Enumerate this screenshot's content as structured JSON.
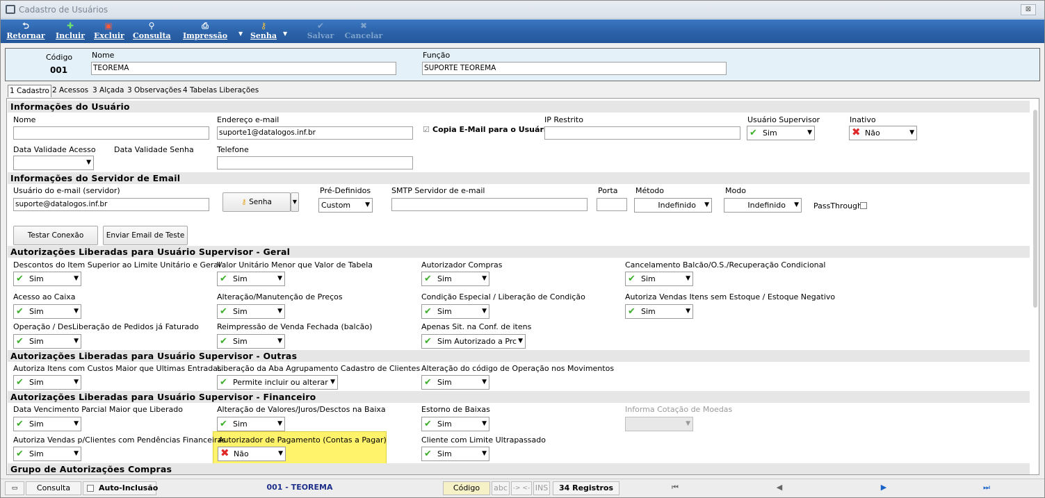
{
  "window": {
    "title": "Cadastro de Usuários",
    "close_label": "⊠"
  },
  "toolbar": {
    "retornar": "Retornar",
    "incluir": "Incluir",
    "excluir": "Excluir",
    "consulta": "Consulta",
    "impressao": "Impressão",
    "senha": "Senha",
    "salvar": "Salvar",
    "cancelar": "Cancelar"
  },
  "header": {
    "codigo_label": "Código",
    "codigo_value": "001",
    "nome_label": "Nome",
    "nome_value": "TEOREMA",
    "funcao_label": "Função",
    "funcao_value": "SUPORTE TEOREMA"
  },
  "tabs": [
    "1 Cadastro",
    "2 Acessos",
    "3 Alçada",
    "3 Observações",
    "4 Tabelas Liberações"
  ],
  "usuario": {
    "section": "Informações do Usuário",
    "nome_label": "Nome",
    "nome_value": "",
    "email_label": "Endereço e-mail",
    "email_value": "suporte1@datalogos.inf.br",
    "copia_label": "Copia E-Mail para o Usuário",
    "ip_label": "IP Restrito",
    "ip_value": "",
    "supervisor_label": "Usuário Supervisor",
    "supervisor_value": "Sim",
    "inativo_label": "Inativo",
    "inativo_value": "Não",
    "validade_acesso_label": "Data Validade Acesso",
    "validade_senha_label": "Data Validade Senha",
    "telefone_label": "Telefone",
    "telefone_value": ""
  },
  "servidor": {
    "section": "Informações do Servidor de Email",
    "usuario_label": "Usuário do e-mail (servidor)",
    "usuario_value": "suporte@datalogos.inf.br",
    "senha_button": "Senha",
    "predef_label": "Pré-Definidos",
    "predef_value": "Custom",
    "smtp_label": "SMTP Servidor de e-mail",
    "smtp_value": "",
    "porta_label": "Porta",
    "porta_value": "",
    "metodo_label": "Método",
    "metodo_value": "Indefinido",
    "modo_label": "Modo",
    "modo_value": "Indefinido",
    "passthrough_label": "PassThrough",
    "testar_button": "Testar Conexão",
    "enviar_button": "Enviar Email de Teste"
  },
  "geral": {
    "section": "Autorizações Liberadas para Usuário Supervisor - Geral",
    "items": [
      {
        "label": "Descontos do Item Superior ao Limite Unitário e Geral",
        "value": "Sim"
      },
      {
        "label": "Valor Unitário Menor que Valor de Tabela",
        "value": "Sim"
      },
      {
        "label": "Autorizador Compras",
        "value": "Sim"
      },
      {
        "label": "Cancelamento Balcão/O.S./Recuperação Condicional",
        "value": "Sim"
      },
      {
        "label": "Acesso ao Caixa",
        "value": "Sim"
      },
      {
        "label": "Alteração/Manutenção de Preços",
        "value": "Sim"
      },
      {
        "label": "Condição Especial / Liberação de Condição",
        "value": "Sim"
      },
      {
        "label": "Autoriza Vendas Itens sem Estoque / Estoque Negativo",
        "value": "Sim"
      },
      {
        "label": "Operação / DesLiberação de Pedidos já Faturado",
        "value": "Sim"
      },
      {
        "label": "Reimpressão de Venda Fechada (balcão)",
        "value": "Sim"
      },
      {
        "label": "Apenas Sit. na Conf. de itens",
        "value": "Sim Autorizado a Prc"
      }
    ]
  },
  "outras": {
    "section": "Autorizações Liberadas para Usuário Supervisor - Outras",
    "items": [
      {
        "label": "Autoriza Itens com Custos Maior que Ultimas Entradas",
        "value": "Sim"
      },
      {
        "label": "Liberação da Aba Agrupamento Cadastro de Clientes",
        "value": "Permite incluir ou alterar"
      },
      {
        "label": "Alteração do código de Operação nos Movimentos",
        "value": "Sim"
      }
    ]
  },
  "financeiro": {
    "section": "Autorizações Liberadas para Usuário Supervisor - Financeiro",
    "items": [
      {
        "label": "Data Vencimento Parcial Maior que Liberado",
        "value": "Sim"
      },
      {
        "label": "Alteração de Valores/Juros/Desctos na Baixa",
        "value": "Sim"
      },
      {
        "label": "Estorno de Baixas",
        "value": "Sim"
      },
      {
        "label": "Informa Cotação de Moedas",
        "value": ""
      },
      {
        "label": "Autoriza Vendas p/Clientes com Pendências Financeiras",
        "value": "Sim"
      },
      {
        "label": "Autorizador de Pagamento (Contas a Pagar)",
        "value": "Não"
      },
      {
        "label": "Cliente com Limite Ultrapassado",
        "value": "Sim"
      }
    ]
  },
  "compras": {
    "section": "Grupo de Autorizações Compras"
  },
  "status": {
    "consulta": "Consulta",
    "auto_inclusao": "Auto-Inclusão",
    "record": "001 - TEOREMA",
    "order": "Código",
    "abc": "abc",
    "arrows": "-> <-",
    "ins": "INS",
    "registros": "34 Registros",
    "nav_first": "⏮",
    "nav_prev": "◀",
    "nav_next": "▶",
    "nav_last": "⏭"
  },
  "colors": {
    "toolbar": "#2b62a8",
    "highlight": "#fff36b",
    "check": "#3cae2a",
    "cross": "#e02828"
  }
}
